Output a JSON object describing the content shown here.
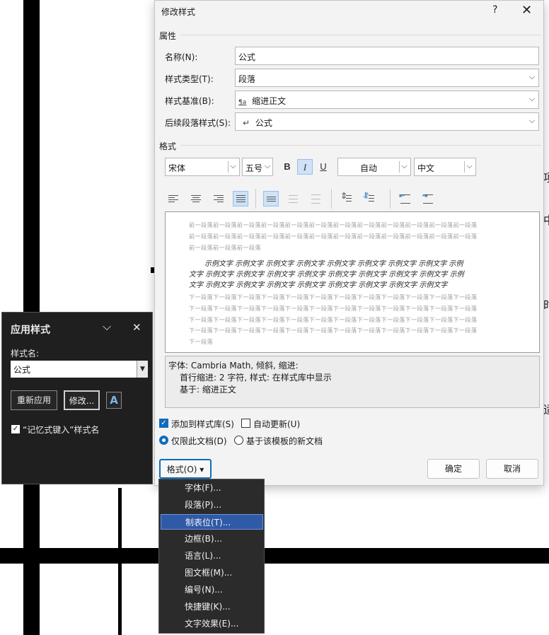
{
  "modify_style_dialog": {
    "title": "修改样式",
    "help_glyph": "?",
    "close_glyph": "✕",
    "properties_section": "属性",
    "name_label": "名称(N):",
    "name_value": "公式",
    "style_type_label": "样式类型(T):",
    "style_type_value": "段落",
    "based_on_label": "样式基准(B):",
    "based_on_value": "缩进正文",
    "based_on_icon": "¶a",
    "following_label": "后续段落样式(S):",
    "following_value": "公式",
    "following_icon": "↵",
    "format_section": "格式",
    "font_value": "宋体",
    "size_value": "五号",
    "bold": "B",
    "italic": "I",
    "underline": "U",
    "color_value": "自动",
    "script_value": "中文",
    "preview": {
      "prev_line1": "前一段落前一段落前一段落前一段落前一段落前一段落前一段落前一段落前一段落前一段落前一段落前一段落",
      "prev_line2": "前一段落前一段落前一段落前一段落前一段落前一段落前一段落前一段落前一段落前一段落前一段落前一段落",
      "prev_line3": "前一段落前一段落前一段落",
      "sample_line1": "示例文字 示例文字 示例文字 示例文字 示例文字 示例文字 示例文字 示例文字 示例",
      "sample_line2": "文字 示例文字 示例文字 示例文字 示例文字 示例文字 示例文字 示例文字 示例文字 示例",
      "sample_line3": "文字 示例文字 示例文字 示例文字 示例文字 示例文字 示例文字 示例文字 示例文字",
      "next_line1": "下一段落下一段落下一段落下一段落下一段落下一段落下一段落下一段落下一段落下一段落下一段落下一段落",
      "next_line2": "下一段落下一段落下一段落下一段落下一段落下一段落下一段落下一段落下一段落下一段落下一段落下一段落",
      "next_line3": "下一段落下一段落下一段落下一段落下一段落下一段落下一段落下一段落下一段落下一段落下一段落下一段落",
      "next_line4": "下一段落下一段落下一段落下一段落下一段落下一段落下一段落下一段落下一段落下一段落下一段落下一段落",
      "next_line5": "下一段落"
    },
    "description": {
      "line1": "字体: Cambria Math, 倾斜, 缩进:",
      "line2": "首行缩进:  2 字符, 样式: 在样式库中显示",
      "line3": "基于: 缩进正文"
    },
    "add_to_gallery_label": "添加到样式库(S)",
    "add_to_gallery_checked": true,
    "auto_update_label": "自动更新(U)",
    "auto_update_checked": false,
    "only_this_doc_label": "仅限此文档(D)",
    "template_docs_label": "基于该模板的新文档",
    "format_button_label": "格式(O) ▾",
    "ok_label": "确定",
    "cancel_label": "取消",
    "accent_color": "#0f6cbd"
  },
  "format_menu": {
    "items": [
      "字体(F)...",
      "段落(P)...",
      "制表位(T)...",
      "边框(B)...",
      "语言(L)...",
      "图文框(M)...",
      "编号(N)...",
      "快捷键(K)...",
      "文字效果(E)..."
    ],
    "selected_index": 2
  },
  "apply_styles_panel": {
    "title": "应用样式",
    "chevron_glyph": "⌵",
    "close_glyph": "✕",
    "style_name_label": "样式名:",
    "style_name_value": "公式",
    "reapply_label": "重新应用",
    "modify_label": "修改...",
    "styles_pane_icon": "A",
    "autocomplete_label": "“记忆式键入”样式名",
    "autocomplete_checked": true
  },
  "background_doc": {
    "edge_chars": [
      "项",
      "中",
      "时",
      "适"
    ]
  }
}
